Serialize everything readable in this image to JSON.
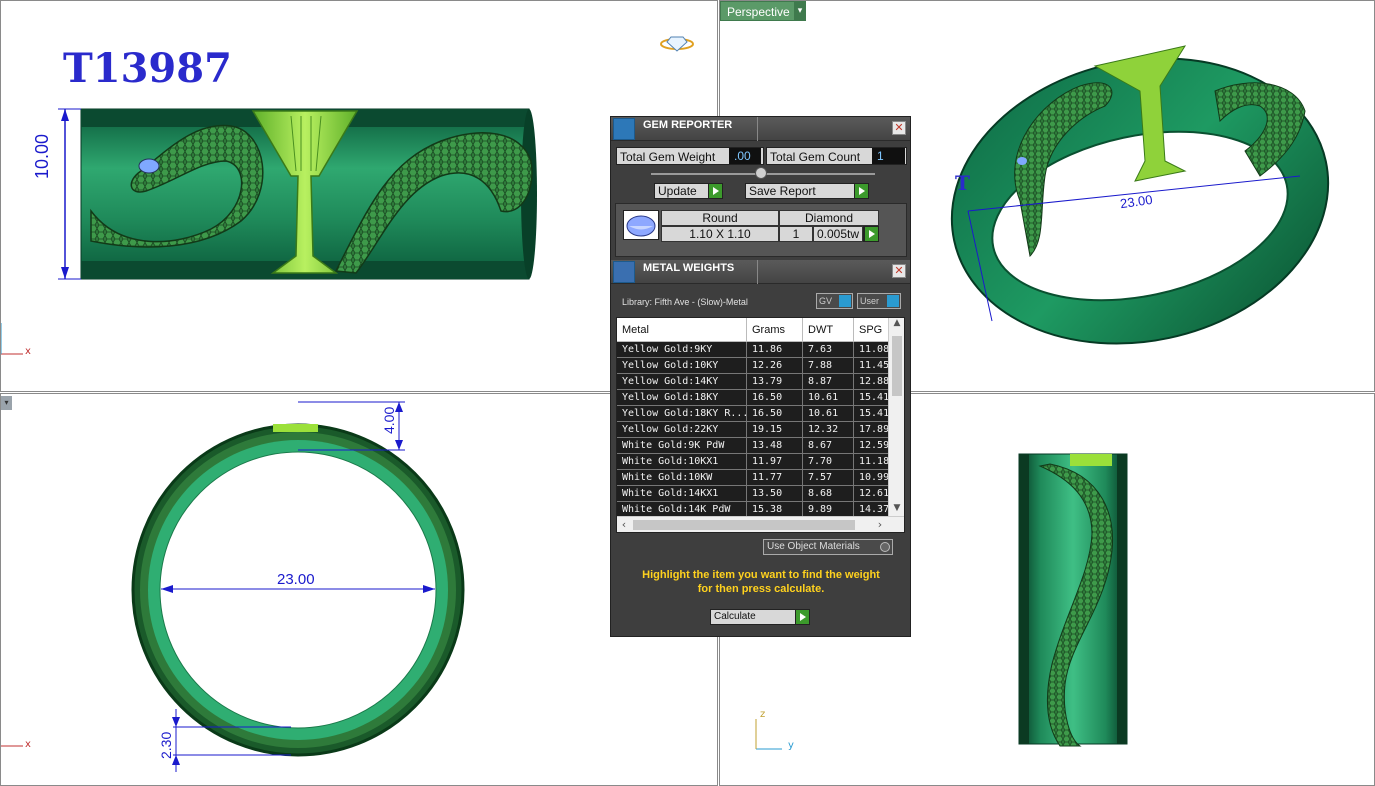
{
  "viewports": {
    "front": {
      "model_id": "T13987",
      "dim_height": "10.00",
      "axis_x": "x",
      "logo_icon": "diamond-ring-icon"
    },
    "perspective": {
      "label": "Perspective",
      "dim_diameter": "23.00",
      "partial_label": "T"
    },
    "top": {
      "dim_top": "4.00",
      "dim_inner": "23.00",
      "dim_bottom": "2.30",
      "axis_x": "x"
    },
    "right": {
      "axis_z": "z",
      "axis_y": "y"
    }
  },
  "gem_reporter": {
    "title": "GEM REPORTER",
    "total_gem_weight_label": "Total Gem Weight",
    "total_gem_weight_value": ".00",
    "total_gem_count_label": "Total Gem Count",
    "total_gem_count_value": "1",
    "update_label": "Update",
    "save_report_label": "Save Report",
    "gem": {
      "shape": "Round",
      "type": "Diamond",
      "size": "1.10 X 1.10",
      "count": "1",
      "weight": "0.005tw"
    }
  },
  "metal_weights": {
    "title": "METAL WEIGHTS",
    "library": "Library: Fifth Ave - (Slow)-Metal",
    "gv_label": "GV",
    "user_label": "User",
    "columns": [
      "Metal",
      "Grams",
      "DWT",
      "SPG"
    ],
    "rows": [
      {
        "metal": "Yellow Gold:9KY",
        "grams": "11.86",
        "dwt": "7.63",
        "spg": "11.08"
      },
      {
        "metal": "Yellow Gold:10KY",
        "grams": "12.26",
        "dwt": "7.88",
        "spg": "11.45"
      },
      {
        "metal": "Yellow Gold:14KY",
        "grams": "13.79",
        "dwt": "8.87",
        "spg": "12.88"
      },
      {
        "metal": "Yellow Gold:18KY",
        "grams": "16.50",
        "dwt": "10.61",
        "spg": "15.41"
      },
      {
        "metal": "Yellow Gold:18KY R...",
        "grams": "16.50",
        "dwt": "10.61",
        "spg": "15.41"
      },
      {
        "metal": "Yellow Gold:22KY",
        "grams": "19.15",
        "dwt": "12.32",
        "spg": "17.89"
      },
      {
        "metal": "White Gold:9K PdW",
        "grams": "13.48",
        "dwt": "8.67",
        "spg": "12.59"
      },
      {
        "metal": "White Gold:10KX1",
        "grams": "11.97",
        "dwt": "7.70",
        "spg": "11.18"
      },
      {
        "metal": "White Gold:10KW",
        "grams": "11.77",
        "dwt": "7.57",
        "spg": "10.99"
      },
      {
        "metal": "White Gold:14KX1",
        "grams": "13.50",
        "dwt": "8.68",
        "spg": "12.61"
      },
      {
        "metal": "White Gold:14K PdW",
        "grams": "15.38",
        "dwt": "9.89",
        "spg": "14.37"
      }
    ],
    "use_object_materials_label": "Use Object Materials",
    "hint_line1": "Highlight the item you want to find the weight",
    "hint_line2": "for then press calculate.",
    "calculate_label": "Calculate"
  },
  "colors": {
    "ring_dark": "#0a5a3a",
    "ring_mid": "#1f8a5a",
    "ring_light": "#3fbf85",
    "accent_green": "#9be03a",
    "dim_blue": "#1a1acc",
    "panel_bg": "#3e3e3e",
    "hint_yellow": "#ffd21e"
  }
}
